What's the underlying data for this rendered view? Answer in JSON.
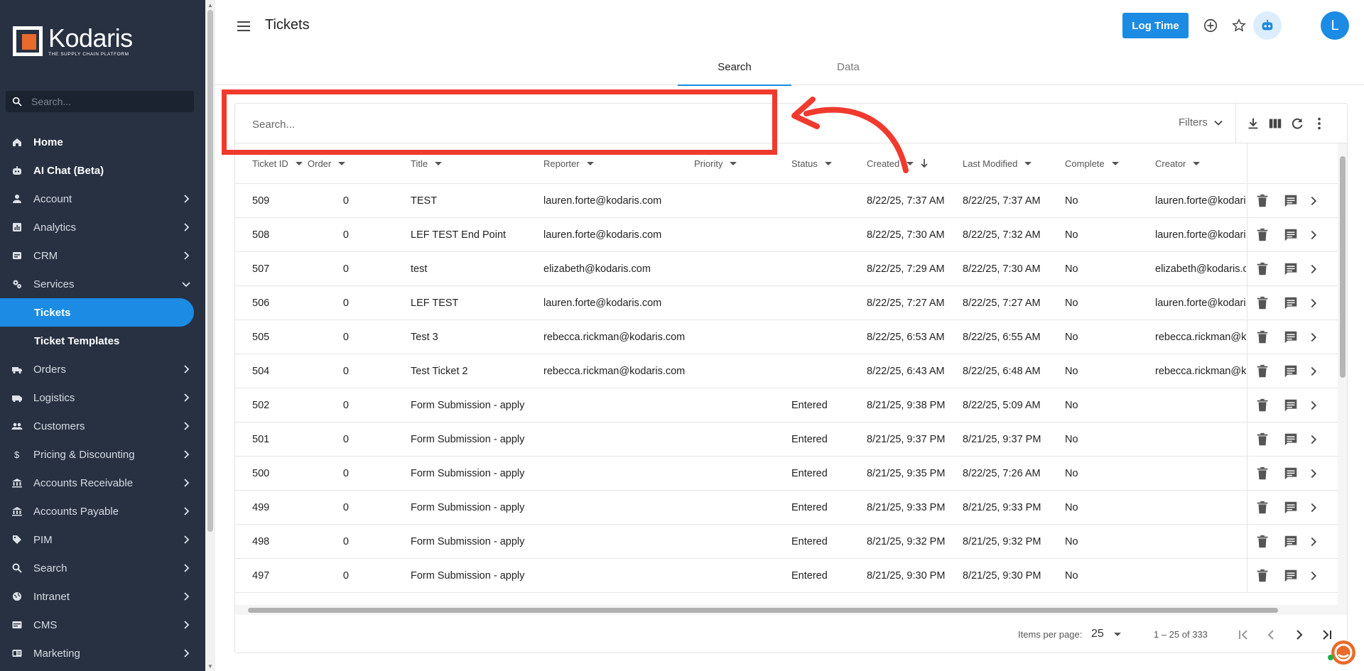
{
  "brand": {
    "name": "Kodaris",
    "tagline": "THE SUPPLY CHAIN PLATFORM",
    "accent": "#1b8be4",
    "logo_orange": "#e86a2c"
  },
  "sidebar": {
    "search_placeholder": "Search...",
    "items": [
      {
        "label": "Home",
        "icon": "home-icon"
      },
      {
        "label": "AI Chat (Beta)",
        "icon": "robot-icon"
      },
      {
        "label": "Account",
        "icon": "person-icon"
      },
      {
        "label": "Analytics",
        "icon": "chart-icon"
      },
      {
        "label": "CRM",
        "icon": "crm-icon"
      },
      {
        "label": "Services",
        "icon": "gears-icon"
      },
      {
        "label": "Tickets"
      },
      {
        "label": "Ticket Templates"
      },
      {
        "label": "Orders",
        "icon": "truck-icon"
      },
      {
        "label": "Logistics",
        "icon": "van-icon"
      },
      {
        "label": "Customers",
        "icon": "people-icon"
      },
      {
        "label": "Pricing & Discounting",
        "icon": "dollar-icon"
      },
      {
        "label": "Accounts Receivable",
        "icon": "bank-icon"
      },
      {
        "label": "Accounts Payable",
        "icon": "bank-icon"
      },
      {
        "label": "PIM",
        "icon": "tag-icon"
      },
      {
        "label": "Search",
        "icon": "search-icon"
      },
      {
        "label": "Intranet",
        "icon": "globe-icon"
      },
      {
        "label": "CMS",
        "icon": "cms-icon"
      },
      {
        "label": "Marketing",
        "icon": "marketing-icon"
      }
    ]
  },
  "header": {
    "title": "Tickets",
    "log_time": "Log Time",
    "avatar": "L",
    "tabs": [
      "Search",
      "Data"
    ]
  },
  "toolbar": {
    "search_placeholder": "Search...",
    "filters": "Filters"
  },
  "table": {
    "columns": [
      "Ticket ID",
      "Order",
      "Title",
      "Reporter",
      "Priority",
      "Status",
      "Created",
      "Last Modified",
      "Complete",
      "Creator"
    ],
    "rows": [
      [
        "509",
        "0",
        "TEST",
        "lauren.forte@kodaris.com",
        "",
        "",
        "8/22/25, 7:37 AM",
        "8/22/25, 7:37 AM",
        "No",
        "lauren.forte@kodaris.com"
      ],
      [
        "508",
        "0",
        "LEF TEST End Point",
        "lauren.forte@kodaris.com",
        "",
        "",
        "8/22/25, 7:30 AM",
        "8/22/25, 7:32 AM",
        "No",
        "lauren.forte@kodaris.com"
      ],
      [
        "507",
        "0",
        "test",
        "elizabeth@kodaris.com",
        "",
        "",
        "8/22/25, 7:29 AM",
        "8/22/25, 7:30 AM",
        "No",
        "elizabeth@kodaris.com"
      ],
      [
        "506",
        "0",
        "LEF TEST",
        "lauren.forte@kodaris.com",
        "",
        "",
        "8/22/25, 7:27 AM",
        "8/22/25, 7:27 AM",
        "No",
        "lauren.forte@kodaris.com"
      ],
      [
        "505",
        "0",
        "Test 3",
        "rebecca.rickman@kodaris.com",
        "",
        "",
        "8/22/25, 6:53 AM",
        "8/22/25, 6:55 AM",
        "No",
        "rebecca.rickman@kodaris.com"
      ],
      [
        "504",
        "0",
        "Test Ticket 2",
        "rebecca.rickman@kodaris.com",
        "",
        "",
        "8/22/25, 6:43 AM",
        "8/22/25, 6:48 AM",
        "No",
        "rebecca.rickman@kodaris.com"
      ],
      [
        "502",
        "0",
        "Form Submission - apply",
        "",
        "",
        "Entered",
        "8/21/25, 9:38 PM",
        "8/22/25, 5:09 AM",
        "No",
        ""
      ],
      [
        "501",
        "0",
        "Form Submission - apply",
        "",
        "",
        "Entered",
        "8/21/25, 9:37 PM",
        "8/21/25, 9:37 PM",
        "No",
        ""
      ],
      [
        "500",
        "0",
        "Form Submission - apply",
        "",
        "",
        "Entered",
        "8/21/25, 9:35 PM",
        "8/22/25, 7:26 AM",
        "No",
        ""
      ],
      [
        "499",
        "0",
        "Form Submission - apply",
        "",
        "",
        "Entered",
        "8/21/25, 9:33 PM",
        "8/21/25, 9:33 PM",
        "No",
        ""
      ],
      [
        "498",
        "0",
        "Form Submission - apply",
        "",
        "",
        "Entered",
        "8/21/25, 9:32 PM",
        "8/21/25, 9:32 PM",
        "No",
        ""
      ],
      [
        "497",
        "0",
        "Form Submission - apply",
        "",
        "",
        "Entered",
        "8/21/25, 9:30 PM",
        "8/21/25, 9:30 PM",
        "No",
        ""
      ]
    ]
  },
  "pager": {
    "label": "Items per page:",
    "size": "25",
    "range": "1 – 25 of 333"
  },
  "annotation": {
    "color": "#f03a2e"
  }
}
